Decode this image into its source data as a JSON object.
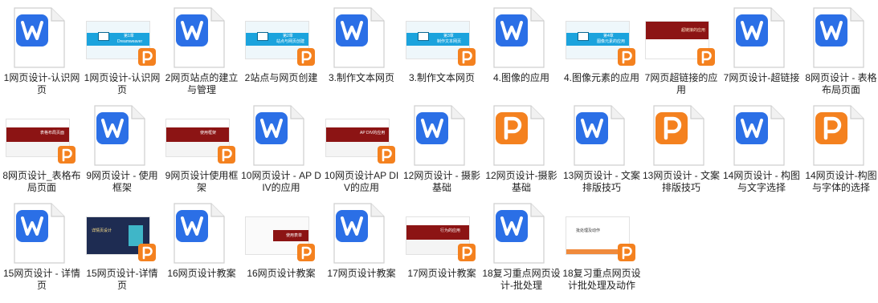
{
  "files": [
    {
      "label": "1网页设计-认识网页",
      "type": "doc"
    },
    {
      "label": "1网页设计-认识网页",
      "type": "ppt",
      "theme": "cyan",
      "title": "第1章",
      "subtitle": "Dreamweaver"
    },
    {
      "label": "2网页站点的建立与管理",
      "type": "doc"
    },
    {
      "label": "2站点与网页创建",
      "type": "ppt",
      "theme": "cyan",
      "title": "第2章",
      "subtitle": "站点与网页创建"
    },
    {
      "label": "3.制作文本网页",
      "type": "doc"
    },
    {
      "label": "3.制作文本网页",
      "type": "ppt",
      "theme": "cyan",
      "title": "第3章",
      "subtitle": "制作文本网页"
    },
    {
      "label": "4.图像的应用",
      "type": "doc"
    },
    {
      "label": "4.图像元素的应用",
      "type": "ppt",
      "theme": "cyan",
      "title": "第4章",
      "subtitle": "图像元素的应用"
    },
    {
      "label": "7网页超链接的应用",
      "type": "ppt",
      "theme": "red-top",
      "title": "超链接的应用"
    },
    {
      "label": "7网页设计-超链接",
      "type": "doc"
    },
    {
      "label": "8网页设计 - 表格布局页面",
      "type": "doc"
    },
    {
      "label": "8网页设计_表格布局页面",
      "type": "ppt",
      "theme": "red-band",
      "title": "表格布局页面"
    },
    {
      "label": "9网页设计 - 使用框架",
      "type": "doc"
    },
    {
      "label": "9网页设计使用框架",
      "type": "ppt",
      "theme": "red-band",
      "title": "使用框架"
    },
    {
      "label": "10网页设计 - AP DIV的应用",
      "type": "doc"
    },
    {
      "label": "10网页设计AP DIV的应用",
      "type": "ppt",
      "theme": "red-band",
      "title": "AP DIV的应用"
    },
    {
      "label": "12网页设计 - 摄影基础",
      "type": "doc"
    },
    {
      "label": "12网页设计-摄影基础",
      "type": "pptbig"
    },
    {
      "label": "13网页设计 - 文案排版技巧",
      "type": "doc"
    },
    {
      "label": "13网页设计 - 文案排版技巧",
      "type": "pptbig"
    },
    {
      "label": "14网页设计 - 构图与文字选择",
      "type": "doc"
    },
    {
      "label": "14网页设计-构图与字体的选择",
      "type": "pptbig"
    },
    {
      "label": "15网页设计 - 详情页",
      "type": "doc"
    },
    {
      "label": "15网页设计-详情页",
      "type": "ppt",
      "theme": "navy",
      "title": "详情页设计"
    },
    {
      "label": "16网页设计教案",
      "type": "doc"
    },
    {
      "label": "16网页设计教案",
      "type": "ppt",
      "theme": "red-right",
      "title": "使用表单"
    },
    {
      "label": "17网页设计教案",
      "type": "doc"
    },
    {
      "label": "17网页设计教案",
      "type": "ppt",
      "theme": "red-band",
      "title": "行为的应用"
    },
    {
      "label": "18复习重点网页设计-批处理",
      "type": "doc"
    },
    {
      "label": "18复习重点网页设计批处理及动作",
      "type": "ppt",
      "theme": "white",
      "title": "批处理及动作"
    }
  ],
  "colors": {
    "doc_blue": "#2b6fe6",
    "ppt_orange": "#f4811f",
    "cyan_band": "#1ba3dd",
    "red_band": "#8c1414",
    "navy": "#1e2c52"
  }
}
